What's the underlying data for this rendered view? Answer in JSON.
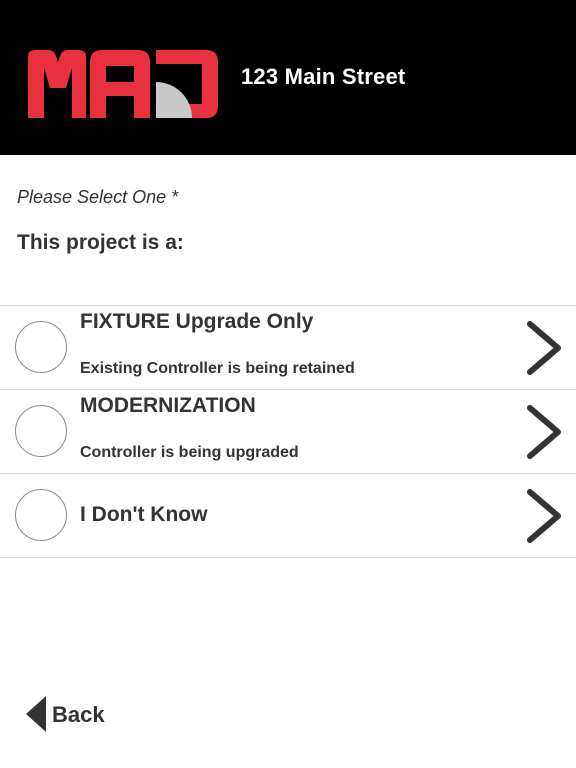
{
  "header": {
    "address": "123 Main Street",
    "logo_text": "MAD",
    "brand_color": "#e8303f",
    "accent_gray": "#c8c8c8",
    "background": "#000000"
  },
  "form": {
    "prompt": "Please Select One *",
    "question": "This project is a:"
  },
  "options": [
    {
      "title": "FIXTURE Upgrade Only",
      "subtitle": "Existing Controller is being retained",
      "selected": false,
      "icon": "chevron-right-icon"
    },
    {
      "title": "MODERNIZATION",
      "subtitle": "Controller is being upgraded",
      "selected": false,
      "icon": "chevron-right-icon"
    },
    {
      "title": "I Don't Know",
      "subtitle": "",
      "selected": false,
      "icon": "chevron-right-icon"
    }
  ],
  "footer": {
    "back_label": "Back",
    "back_icon": "triangle-left-icon"
  }
}
